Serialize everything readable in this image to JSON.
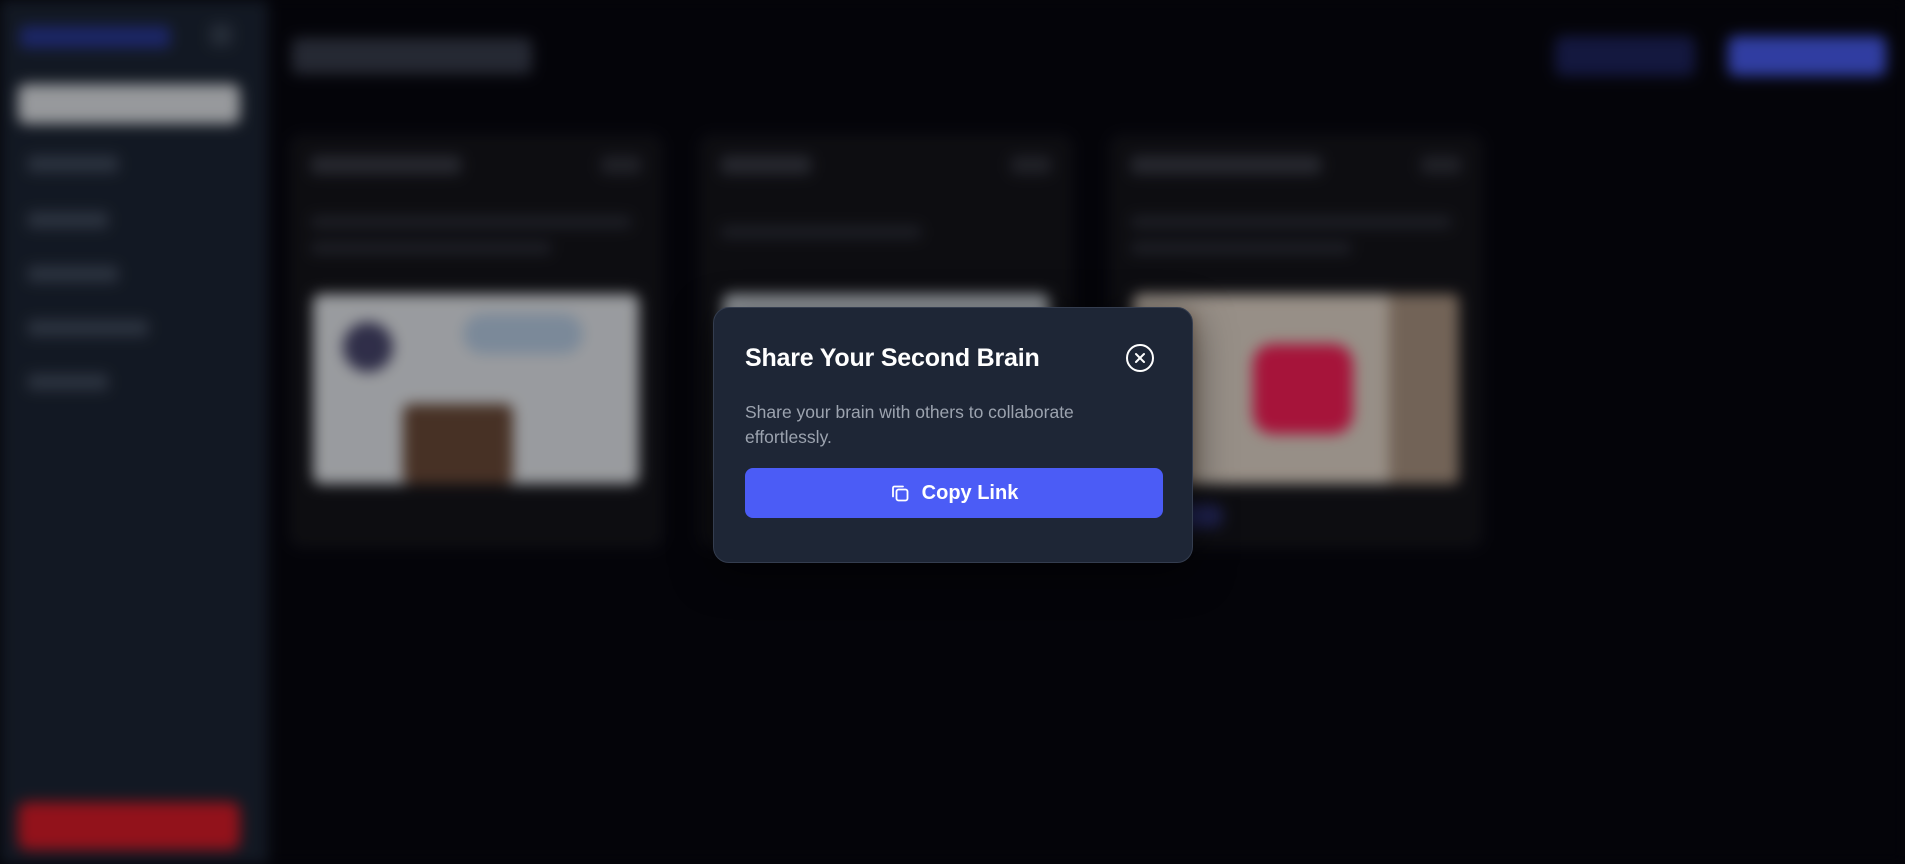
{
  "modal": {
    "title": "Share Your Second Brain",
    "description": "Share your brain with others to collaborate effortlessly.",
    "copy_button_label": "Copy Link",
    "close_icon": "close-circle-icon",
    "copy_icon": "copy-icon"
  },
  "colors": {
    "accent": "#4b5cf6",
    "modal_background": "#1e2636",
    "sidebar_background": "#1d2636",
    "page_background": "#07070f",
    "danger": "#e11d2a"
  }
}
